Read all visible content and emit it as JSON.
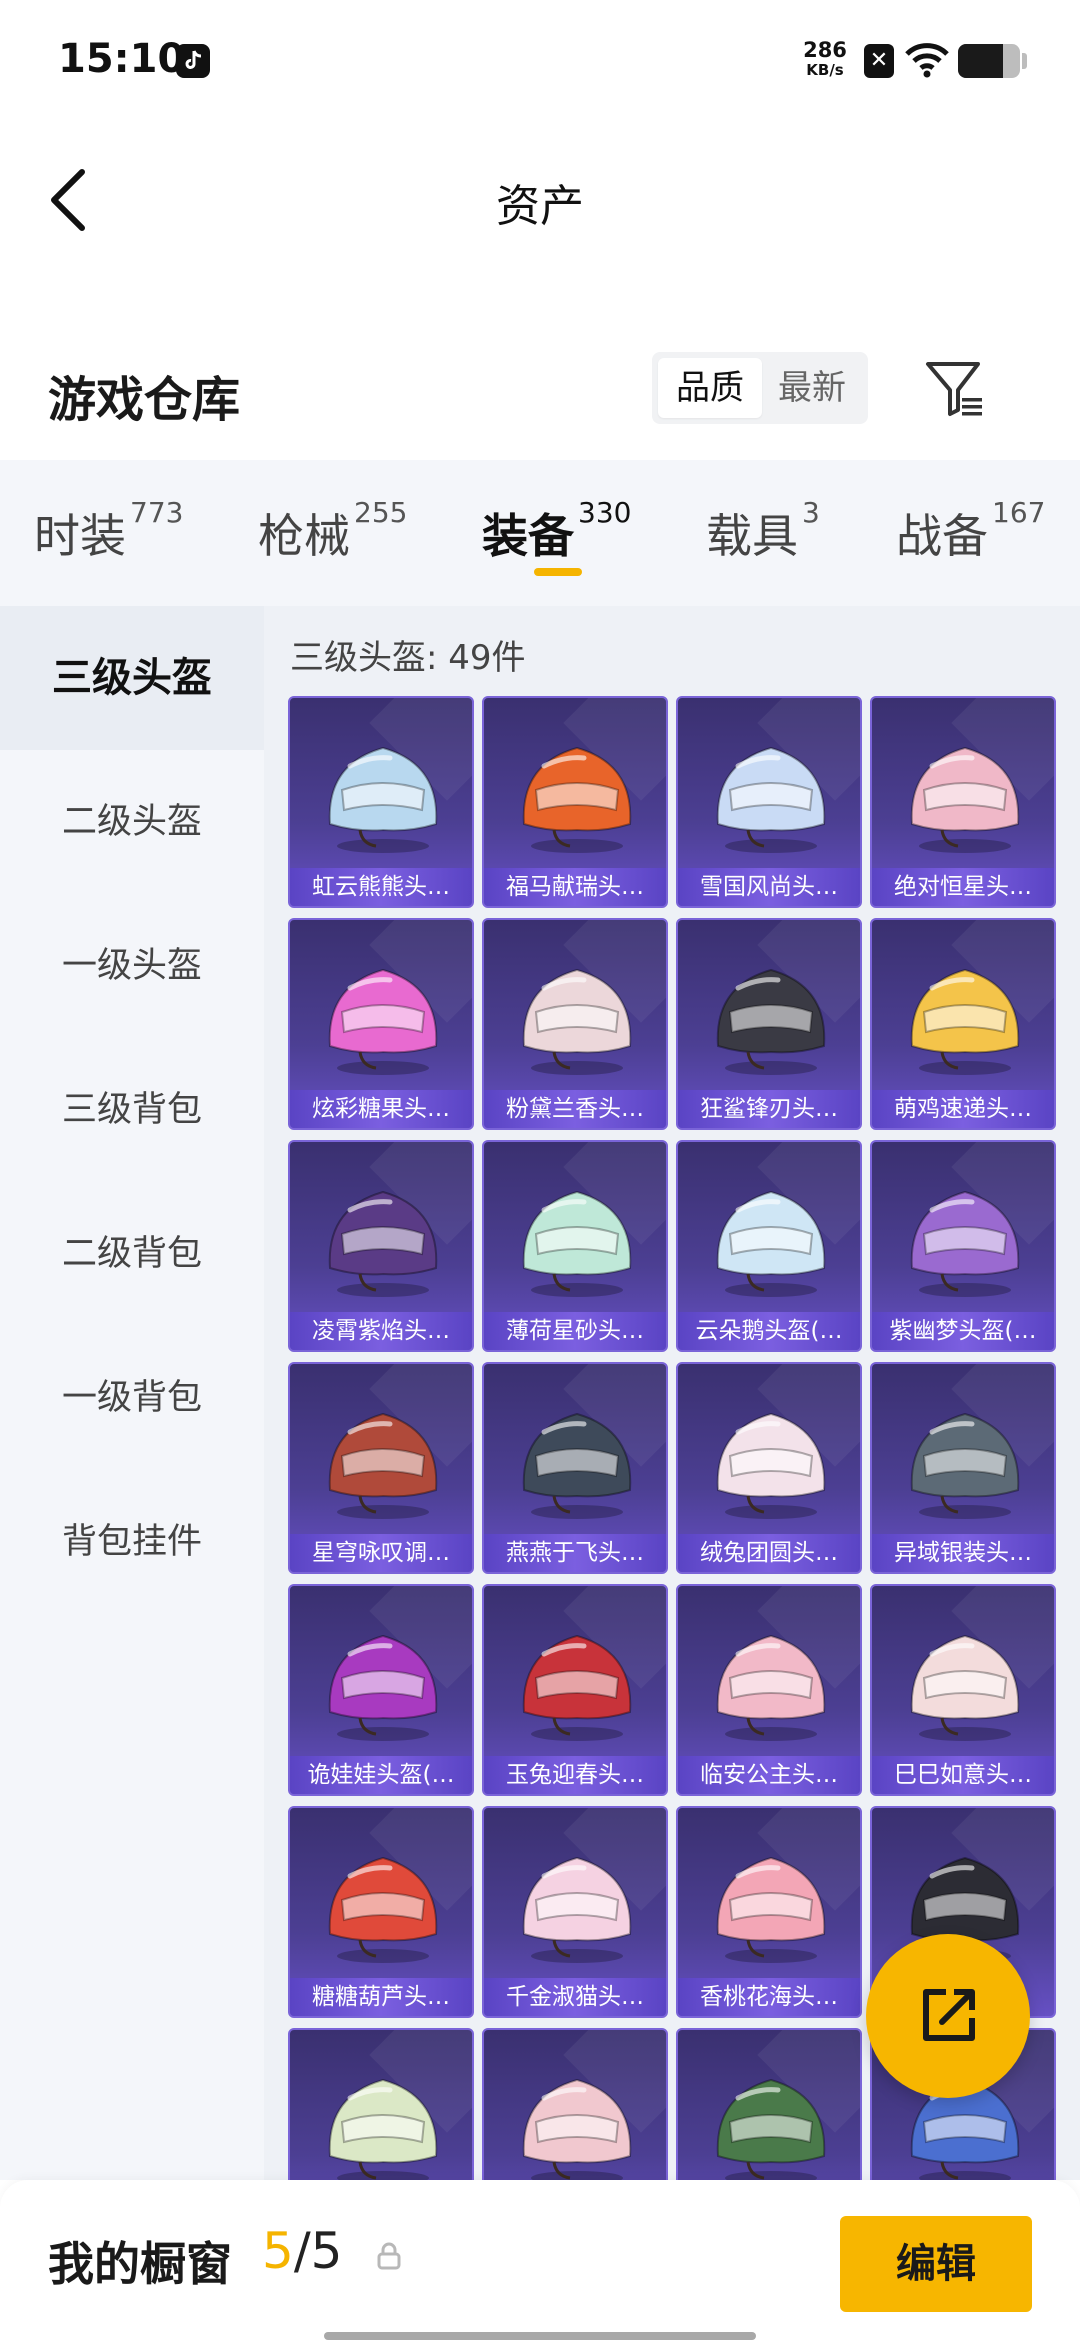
{
  "status_bar": {
    "time": "15:10",
    "net_speed": "286",
    "net_unit": "KB/s",
    "battery_level": 0.72
  },
  "nav": {
    "title": "资产"
  },
  "warehouse": {
    "title": "游戏仓库",
    "sort_options": [
      "品质",
      "最新"
    ],
    "sort_selected": "品质"
  },
  "category_tabs": [
    {
      "label": "时装",
      "count": "773"
    },
    {
      "label": "枪械",
      "count": "255"
    },
    {
      "label": "装备",
      "count": "330",
      "active": true
    },
    {
      "label": "载具",
      "count": "3"
    },
    {
      "label": "战备",
      "count": "167"
    }
  ],
  "sidebar": [
    {
      "label": "三级头盔",
      "active": true
    },
    {
      "label": "二级头盔"
    },
    {
      "label": "一级头盔"
    },
    {
      "label": "三级背包"
    },
    {
      "label": "二级背包"
    },
    {
      "label": "一级背包"
    },
    {
      "label": "背包挂件"
    }
  ],
  "content": {
    "subtitle": "三级头盔: 49件",
    "items": [
      {
        "name": "虹云熊熊头…",
        "color": "#b8d8ef"
      },
      {
        "name": "福马献瑞头…",
        "color": "#e8642a"
      },
      {
        "name": "雪国风尚头…",
        "color": "#c9dbf5"
      },
      {
        "name": "绝对恒星头…",
        "color": "#f0b8c8"
      },
      {
        "name": "炫彩糖果头…",
        "color": "#e86ad0"
      },
      {
        "name": "粉黛兰香头…",
        "color": "#ecd7da"
      },
      {
        "name": "狂鲨锋刃头…",
        "color": "#3a3a44"
      },
      {
        "name": "萌鸡速递头…",
        "color": "#f4c44a"
      },
      {
        "name": "凌霄紫焰头…",
        "color": "#5a3b86"
      },
      {
        "name": "薄荷星砂头…",
        "color": "#bfe8d8"
      },
      {
        "name": "云朵鹅头盔(…",
        "color": "#cfe6f5"
      },
      {
        "name": "紫幽梦头盔(…",
        "color": "#9a6ad0"
      },
      {
        "name": "星穹咏叹调…",
        "color": "#b04a3a"
      },
      {
        "name": "燕燕于飞头…",
        "color": "#3e4a5a"
      },
      {
        "name": "绒兔团圆头…",
        "color": "#f3e2ea"
      },
      {
        "name": "异域银装头…",
        "color": "#5c6a76"
      },
      {
        "name": "诡娃娃头盔(…",
        "color": "#a83ac0"
      },
      {
        "name": "玉兔迎春头…",
        "color": "#c8333a"
      },
      {
        "name": "临安公主头…",
        "color": "#f2b9c8"
      },
      {
        "name": "巳巳如意头…",
        "color": "#f3dcdc"
      },
      {
        "name": "糖糖葫芦头…",
        "color": "#e04a3a"
      },
      {
        "name": "千金淑猫头…",
        "color": "#f5d2e2"
      },
      {
        "name": "香桃花海头…",
        "color": "#f3a6b6"
      },
      {
        "name": "",
        "color": "#2c2c34"
      },
      {
        "name": "",
        "color": "#dbe8c6"
      },
      {
        "name": "",
        "color": "#f1c8cf"
      },
      {
        "name": "",
        "color": "#4a7a4a"
      },
      {
        "name": "",
        "color": "#4b6fd0"
      }
    ]
  },
  "bottom_bar": {
    "title": "我的橱窗",
    "current": "5",
    "total": "/5",
    "edit_label": "编辑"
  }
}
